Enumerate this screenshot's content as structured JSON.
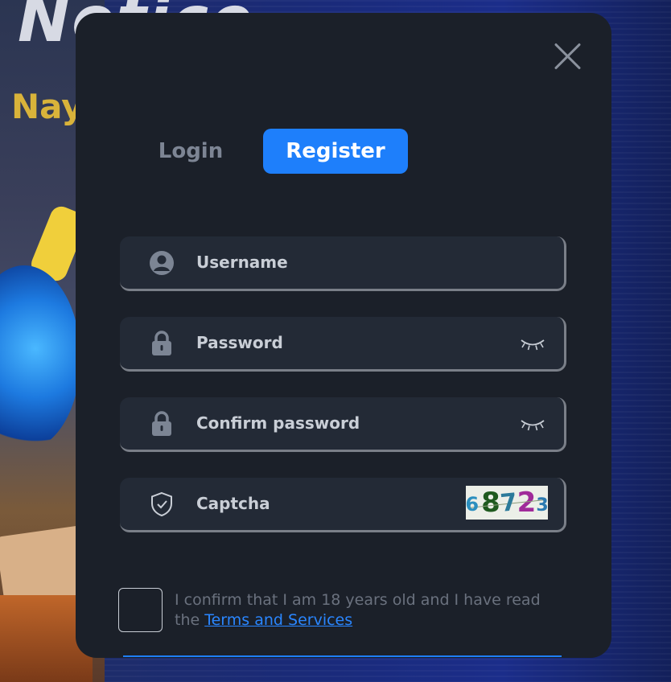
{
  "background": {
    "notice_text": "Notice",
    "nay_text": "Nay"
  },
  "modal": {
    "tabs": [
      {
        "label": "Login",
        "active": false
      },
      {
        "label": "Register",
        "active": true
      }
    ],
    "fields": {
      "username": {
        "placeholder": "Username",
        "icon": "user-icon"
      },
      "password": {
        "placeholder": "Password",
        "icon": "lock-icon",
        "toggle_icon": "eye-closed-icon"
      },
      "confirm_password": {
        "placeholder": "Confirm password",
        "icon": "lock-icon",
        "toggle_icon": "eye-closed-icon"
      },
      "captcha": {
        "placeholder": "Captcha",
        "icon": "shield-check-icon",
        "code": [
          "6",
          "8",
          "7",
          "2",
          "3"
        ]
      }
    },
    "agreement": {
      "text": "I confirm that I am 18 years old and I have read the",
      "link": "Terms and Services"
    }
  },
  "colors": {
    "accent": "#1e7ffb",
    "modal_bg": "#1b2029",
    "field_bg": "#232a36",
    "captcha_digits": [
      "#2b8fbf",
      "#1f5a1f",
      "#2b7a9a",
      "#a02a9a",
      "#2b7ab0"
    ]
  }
}
